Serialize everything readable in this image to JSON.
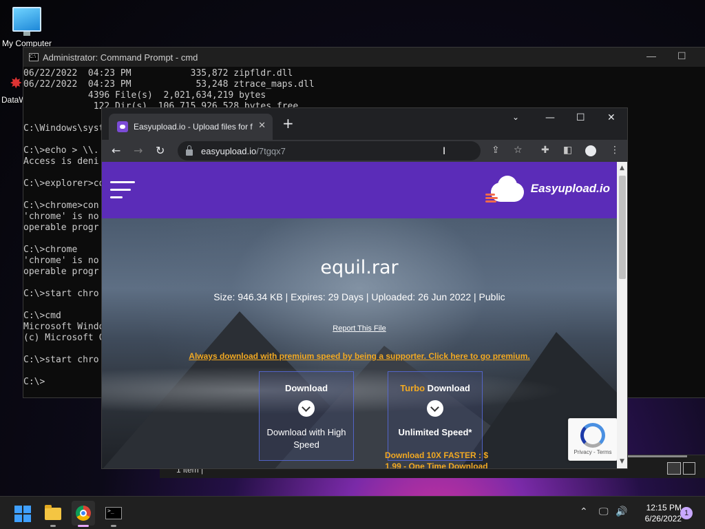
{
  "desktop": {
    "icons": [
      {
        "label": "My Computer"
      },
      {
        "label": "DataW"
      }
    ]
  },
  "cmd": {
    "title": "Administrator: Command Prompt - cmd",
    "lines": [
      "06/22/2022  04:23 PM           335,872 zipfldr.dll",
      "06/22/2022  04:23 PM            53,248 ztrace_maps.dll",
      "            4396 File(s)  2,021,634,219 bytes",
      "             122 Dir(s)  106,715,926,528 bytes free",
      "",
      "C:\\Windows\\syst",
      "",
      "C:\\>echo > \\\\.",
      "Access is deni",
      "",
      "C:\\>explorer>co",
      "",
      "C:\\>chrome>con",
      "'chrome' is no",
      "operable progr",
      "",
      "C:\\>chrome",
      "'chrome' is no",
      "operable progr",
      "",
      "C:\\>start chro",
      "",
      "C:\\>cmd",
      "Microsoft Windo",
      "(c) Microsoft C",
      "",
      "C:\\>start chro",
      "",
      "C:\\>"
    ]
  },
  "explorer": {
    "status": "1 item  |"
  },
  "browser": {
    "tab_title": "Easyupload.io - Upload files for f",
    "url_host": "easyupload.io",
    "url_path": "/7tgqx7"
  },
  "site": {
    "logo_text": "Easyupload.io",
    "file_name": "equil.rar",
    "meta": "Size: 946.34 KB | Expires: 29 Days | Uploaded: 26 Jun 2022 | Public",
    "report": "Report This File",
    "premium": "Always download with premium speed by being a supporter. Click here to go premium.",
    "download": {
      "title": "Download",
      "subtitle": "Download with High Speed"
    },
    "turbo": {
      "title_accent": "Turbo",
      "title": " Download",
      "subtitle": "Unlimited Speed*",
      "note": "Download 10X FASTER : $ 1.99 - One Time Download"
    },
    "recaptcha": {
      "text": "Privacy - Terms"
    }
  },
  "taskbar": {
    "time": "12:15 PM",
    "date": "6/26/2022",
    "notifications": "1"
  },
  "colors": {
    "brand_purple": "#5b2cb8",
    "premium_orange": "#f2a922",
    "taskbar": "#202020"
  }
}
